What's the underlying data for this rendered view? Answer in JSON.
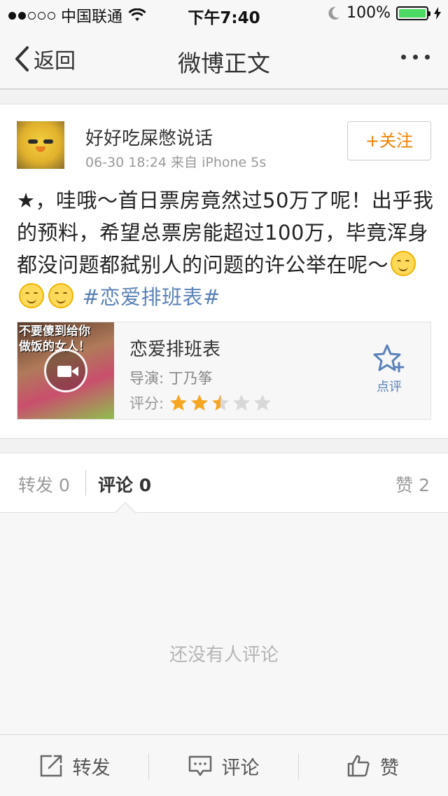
{
  "status_bar": {
    "carrier": "中国联通",
    "time": "下午7:40",
    "battery_percent": "100%",
    "signal_strength_filled": 2,
    "signal_strength_total": 5
  },
  "nav": {
    "back_label": "返回",
    "title": "微博正文"
  },
  "post": {
    "username": "好好吃屎憋说话",
    "meta": "06-30 18:24  来自 iPhone 5s",
    "follow_label": "+关注",
    "text": "★，哇哦～首日票房竟然过50万了呢！出乎我的预料，希望总票房能超过100万，毕竟浑身都没问题都弑别人的问题的许公举在呢～",
    "topic": "#恋爱排班表#",
    "emoji_count": 3
  },
  "movie": {
    "thumb_caption_line1": "不要傻到给你",
    "thumb_caption_line2": "做饭的女人！",
    "title": "恋爱排班表",
    "director": "导演: 丁乃筝",
    "rating_label": "评分:",
    "rating_stars": 2.5,
    "rating_max": 5,
    "review_label": "点评"
  },
  "tabs": {
    "repost": "转发 0",
    "comment": "评论 0",
    "like": "赞 2"
  },
  "comments": {
    "empty_text": "还没有人评论"
  },
  "toolbar": {
    "repost_label": "转发",
    "comment_label": "评论",
    "like_label": "赞"
  },
  "colors": {
    "accent_orange": "#f08200",
    "link_blue": "#5a82b8",
    "star_filled": "#f5a623",
    "star_empty": "#d8d8d8",
    "battery_green": "#4cd964"
  }
}
